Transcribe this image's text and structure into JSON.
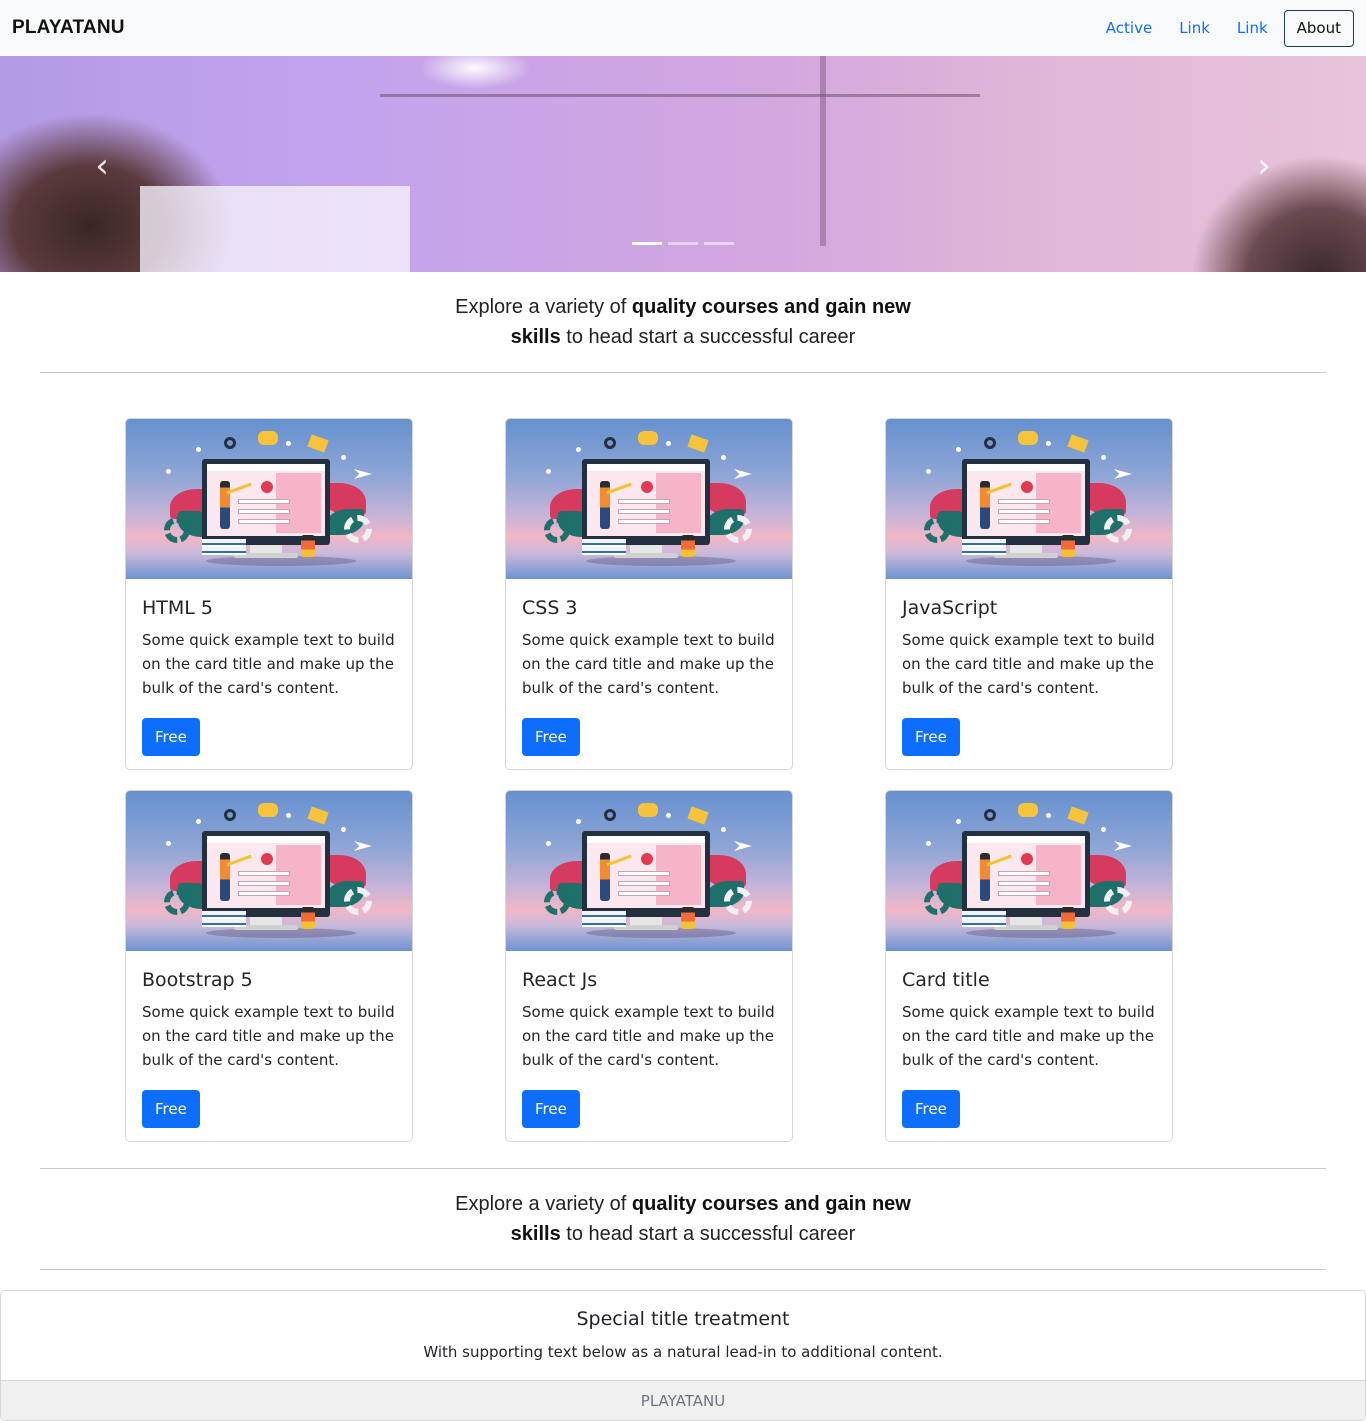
{
  "navbar": {
    "brand": "PLAYATANU",
    "links": [
      "Active",
      "Link",
      "Link"
    ],
    "about_button": "About",
    "colors": {
      "link": "#0d6efd",
      "background": "#f8f9fa"
    }
  },
  "carousel": {
    "prev_icon": "chevron-left-icon",
    "next_icon": "chevron-right-icon",
    "prev_glyph": "‹",
    "next_glyph": "›",
    "slide_count": 3,
    "active_slide": 1
  },
  "tagline": {
    "part1": "Explore a variety of ",
    "bold1": "quality courses and gain new",
    "bold2": "skills",
    "part2": " to head start a successful career"
  },
  "cards": [
    {
      "title": "HTML 5",
      "text": "Some quick example text to build on the card title and make up the bulk of the card's content.",
      "button": "Free"
    },
    {
      "title": "CSS 3",
      "text": "Some quick example text to build on the card title and make up the bulk of the card's content.",
      "button": "Free"
    },
    {
      "title": "JavaScript",
      "text": "Some quick example text to build on the card title and make up the bulk of the card's content.",
      "button": "Free"
    },
    {
      "title": "Bootstrap 5",
      "text": "Some quick example text to build on the card title and make up the bulk of the card's content.",
      "button": "Free"
    },
    {
      "title": "React Js",
      "text": "Some quick example text to build on the card title and make up the bulk of the card's content.",
      "button": "Free"
    },
    {
      "title": "Card title",
      "text": "Some quick example text to build on the card title and make up the bulk of the card's content.",
      "button": "Free"
    }
  ],
  "footer": {
    "title": "Special title treatment",
    "text": "With supporting text below as a natural lead-in to additional content.",
    "bar": "PLAYATANU"
  },
  "colors": {
    "primary": "#0d6efd",
    "text": "#212529",
    "muted": "#6c757d"
  }
}
